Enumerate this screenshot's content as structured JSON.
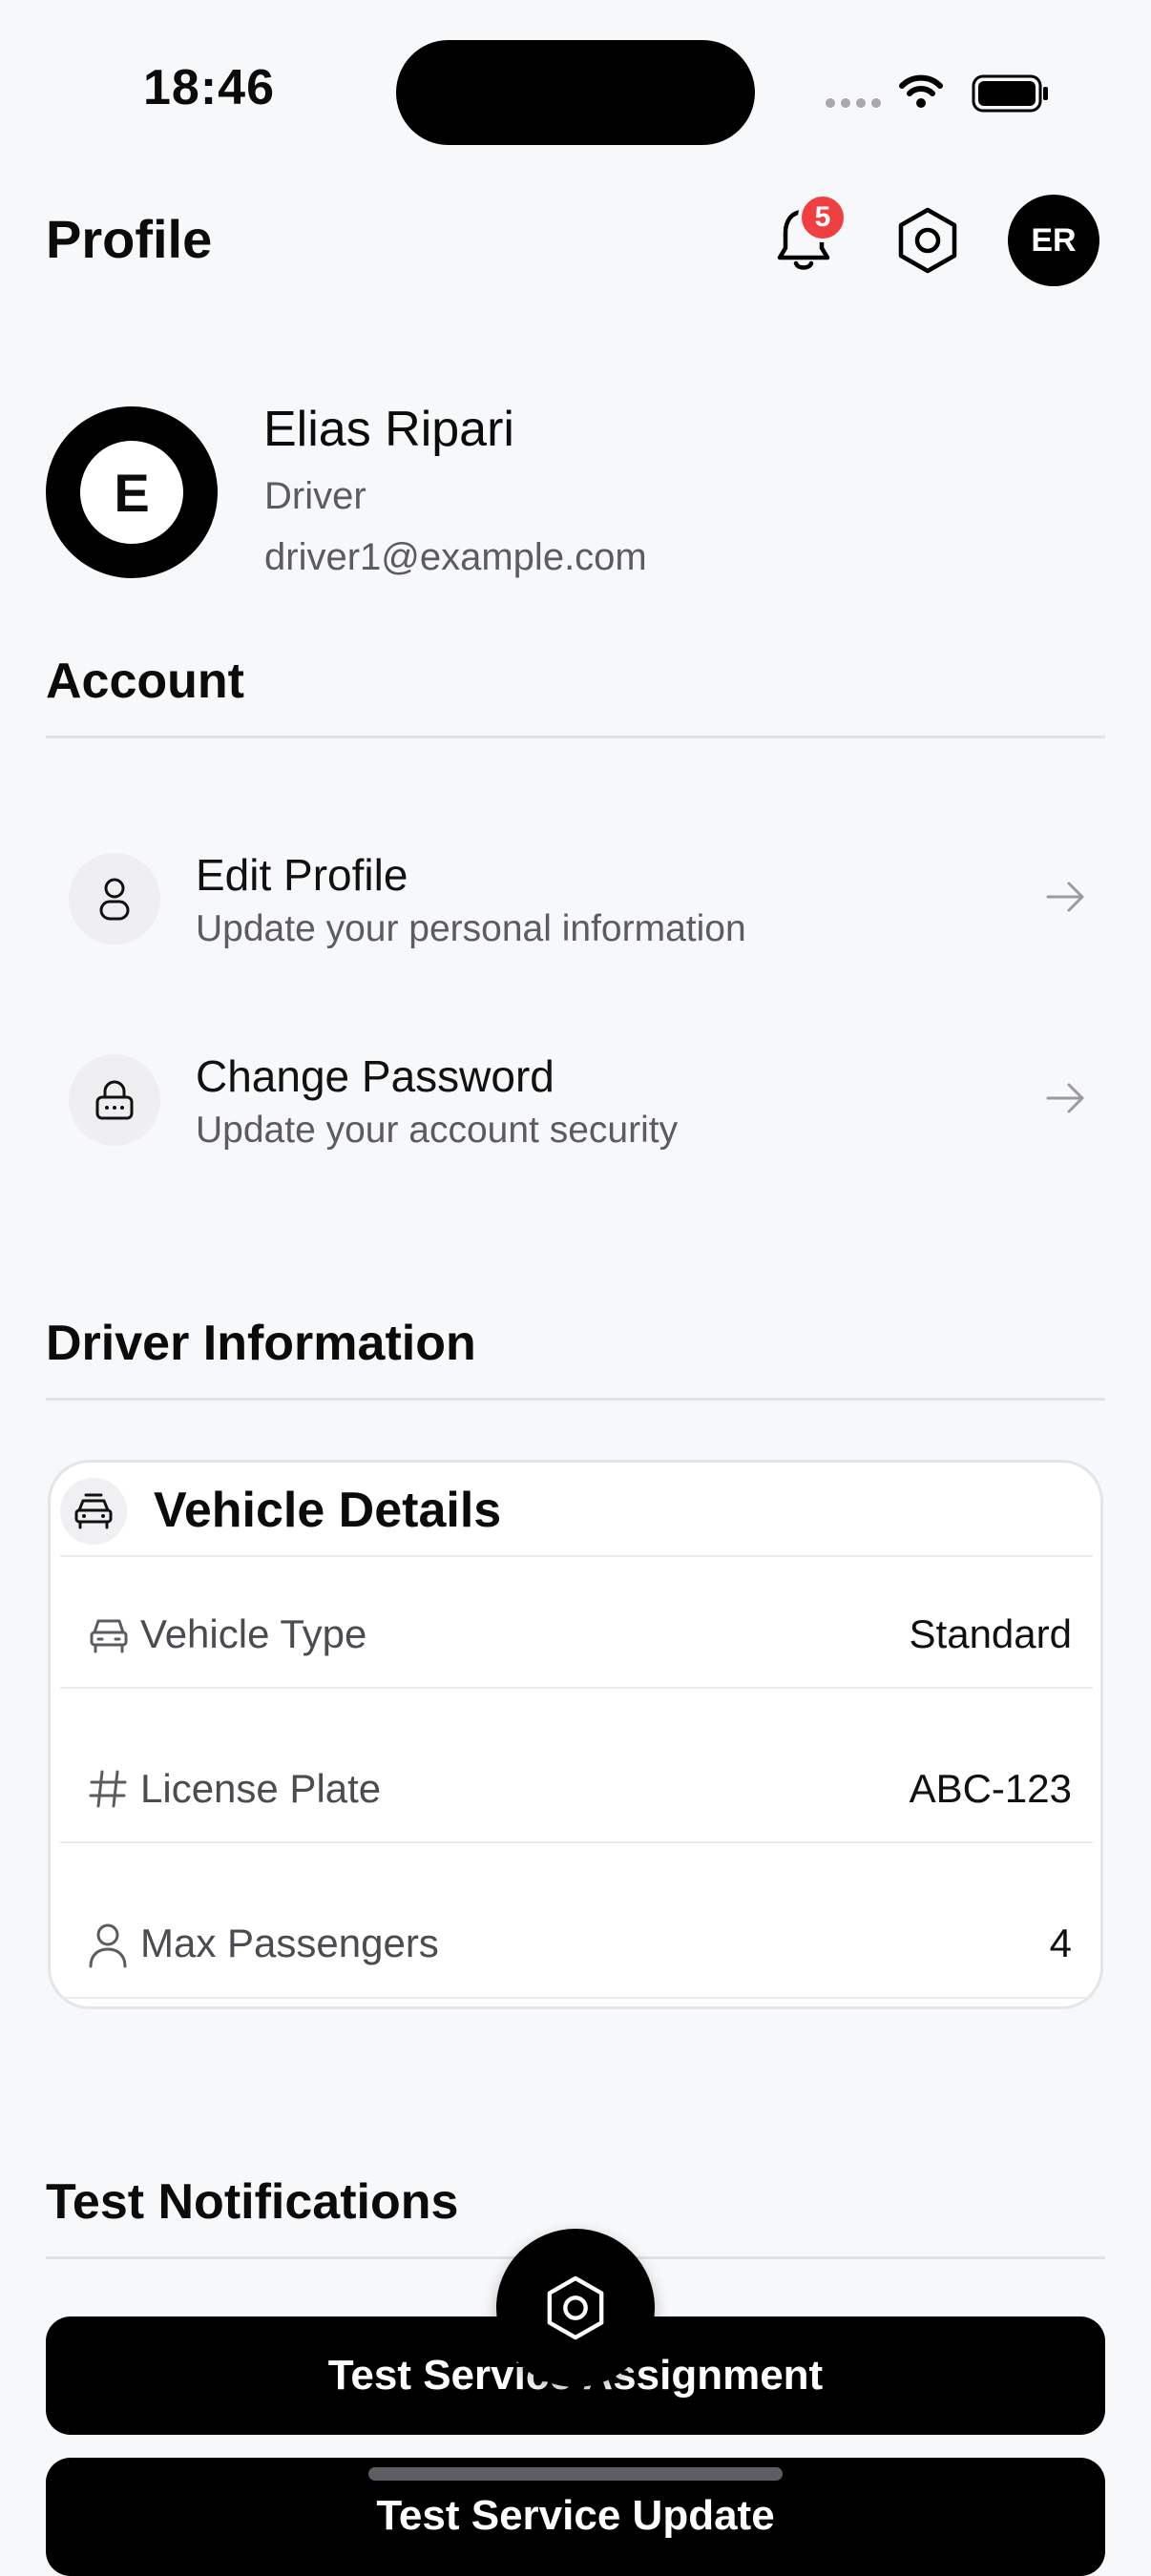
{
  "status_bar": {
    "time": "18:46"
  },
  "header": {
    "title": "Profile",
    "notification_count": "5",
    "avatar_initials": "ER"
  },
  "profile": {
    "avatar_letter": "E",
    "name": "Elias Ripari",
    "role": "Driver",
    "email": "driver1@example.com"
  },
  "account": {
    "section_title": "Account",
    "items": [
      {
        "title": "Edit Profile",
        "subtitle": "Update your personal information",
        "icon": "user-icon"
      },
      {
        "title": "Change Password",
        "subtitle": "Update your account security",
        "icon": "lock-icon"
      }
    ]
  },
  "driver_info": {
    "section_title": "Driver Information",
    "card_title": "Vehicle Details",
    "rows": [
      {
        "label": "Vehicle Type",
        "value": "Standard",
        "icon": "car-icon"
      },
      {
        "label": "License Plate",
        "value": "ABC-123",
        "icon": "hash-icon"
      },
      {
        "label": "Max Passengers",
        "value": "4",
        "icon": "user-icon"
      }
    ]
  },
  "test_notifications": {
    "section_title": "Test Notifications",
    "buttons": [
      {
        "label": "Test Service Assignment"
      },
      {
        "label": "Test Service Update"
      }
    ]
  },
  "colors": {
    "badge": "#ef3f43",
    "primary": "#000000",
    "background": "#f7f8fa"
  }
}
